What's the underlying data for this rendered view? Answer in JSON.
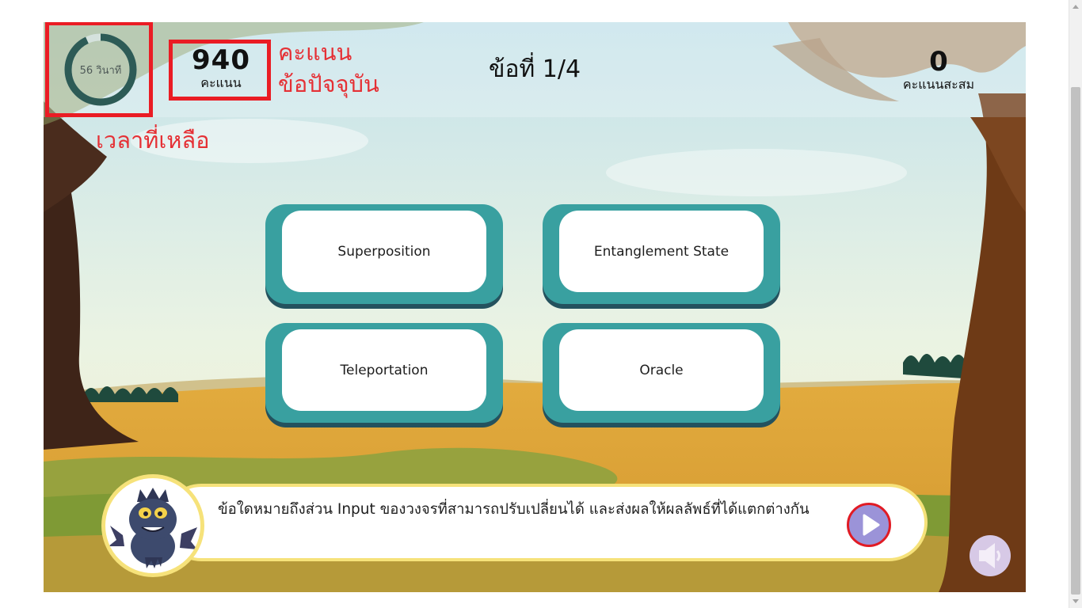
{
  "hud": {
    "timer_text": "56 วินาที",
    "timer_progress": 0.93,
    "score_value": "940",
    "score_label": "คะแนน",
    "question_number": "ข้อที่ 1/4",
    "total_value": "0",
    "total_label": "คะแนนสะสม"
  },
  "annotations": {
    "score_line1": "คะแนน",
    "score_line2": "ข้อปัจจุบัน",
    "timer": "เวลาที่เหลือ"
  },
  "answers": [
    {
      "label": "Superposition"
    },
    {
      "label": "Entanglement State"
    },
    {
      "label": "Teleportation"
    },
    {
      "label": "Oracle"
    }
  ],
  "question": {
    "text": "ข้อใดหมายถึงส่วน Input ของวงจรที่สามารถปรับเปลี่ยนได้ และส่งผลให้ผลลัพธ์ที่ได้แตกต่างกัน"
  },
  "icons": {
    "play": "play-icon",
    "sound": "speaker-icon",
    "mascot": "dragon-mascot"
  },
  "colors": {
    "answer_frame": "#39a0a0",
    "answer_shadow": "#24525e",
    "annotation_red": "#ea1c24",
    "question_border": "#f6e27a",
    "play_fill": "#9b93d8"
  }
}
